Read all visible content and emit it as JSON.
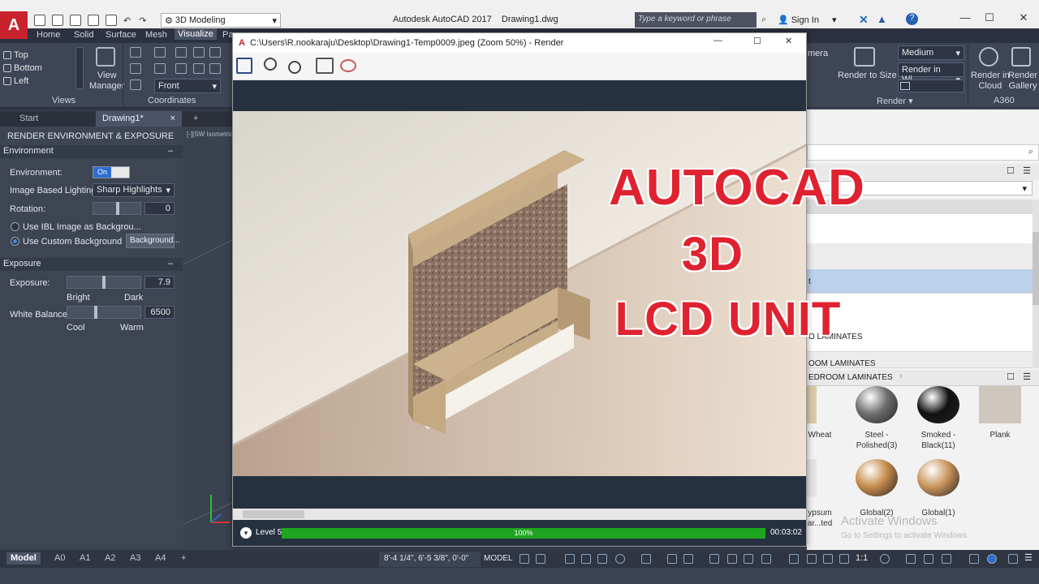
{
  "window": {
    "app_logo": "A",
    "workspace": "3D Modeling",
    "app_title": "Autodesk AutoCAD 2017    Drawing1.dwg",
    "search_placeholder": "Type a keyword or phrase",
    "sign_in": "Sign In"
  },
  "ribbon": {
    "tabs": [
      "Home",
      "Solid",
      "Surface",
      "Mesh",
      "Visualize",
      "Pa"
    ],
    "active_tab": "Visualize",
    "views": [
      "Top",
      "Bottom",
      "Left"
    ],
    "view_manager": "View\nManager",
    "front_dropdown": "Front",
    "sections": {
      "views": "Views",
      "coordinates": "Coordinates",
      "render": "Render",
      "a360": "A360"
    },
    "camera_partial": "mera",
    "render_to_size": "Render to Size",
    "quality_dropdown": "Medium",
    "render_in_dropdown": "Render in Wi...",
    "render_in_cloud": "Render in\nCloud",
    "render_gallery": "Render\nGallery"
  },
  "file_tabs": [
    "Start",
    "Drawing1*"
  ],
  "palette": {
    "title": "RENDER ENVIRONMENT & EXPOSURE",
    "environment_header": "Environment",
    "environment_label": "Environment:",
    "environment_toggle": "On",
    "ibl_label": "Image Based Lighting:",
    "ibl_value": "Sharp Highlights",
    "rotation_label": "Rotation:",
    "rotation_value": "0",
    "radio_ibl": "Use IBL Image as Backgrou...",
    "radio_custom": "Use Custom Background",
    "background_button": "Background...",
    "exposure_header": "Exposure",
    "exposure_label": "Exposure:",
    "exposure_value": "7.9",
    "bright": "Bright",
    "dark": "Dark",
    "white_balance_label": "White Balance:",
    "white_balance_value": "6500",
    "cool": "Cool",
    "warm": "Warm",
    "exposure_level": 0.49,
    "white_balance_level": 0.38
  },
  "viewport_label": "[-][SW Isometric]",
  "render_window": {
    "title": "C:\\Users\\R.nookaraju\\Desktop\\Drawing1-Temp0009.jpeg (Zoom 50%) - Render",
    "level": "Level 5",
    "progress_text": "100%",
    "progress": 1.0,
    "elapsed": "00:03:02"
  },
  "overlay": {
    "line1": "AUTOCAD",
    "line2": "3D",
    "line3": "LCD UNIT"
  },
  "materials": {
    "rows": [
      "t",
      "O LAMINATES",
      "OOM LAMINATES"
    ],
    "breadcrumb": "EDROOM LAMINATES",
    "swatches": [
      {
        "label": "Wheat",
        "color": "#d9c9a8"
      },
      {
        "label": "Steel -\nPolished(3)",
        "color": "#6d6d6d"
      },
      {
        "label": "Smoked -\nBlack(11)",
        "color": "#111111"
      },
      {
        "label": "Plank",
        "color": "#cfc6bd"
      },
      {
        "label": "ypsum\nar...ted",
        "color": "#e4e4e4"
      },
      {
        "label": "Global(2)",
        "color": "#c58a4a"
      },
      {
        "label": "Global(1)",
        "color": "#c9935a"
      }
    ],
    "activate_title": "Activate Windows",
    "activate_sub": "Go to Settings to activate Windows."
  },
  "statusbar": {
    "layout_tabs": [
      "Model",
      "A0",
      "A1",
      "A2",
      "A3",
      "A4"
    ],
    "coordinates": "8'-4 1/4\", 6'-5 3/8\", 0'-0\"",
    "model": "MODEL",
    "scale": "1:1"
  },
  "colors": {
    "accent": "#c8232c",
    "progress_green": "#1fa51f",
    "overlay_red": "#e02230"
  }
}
